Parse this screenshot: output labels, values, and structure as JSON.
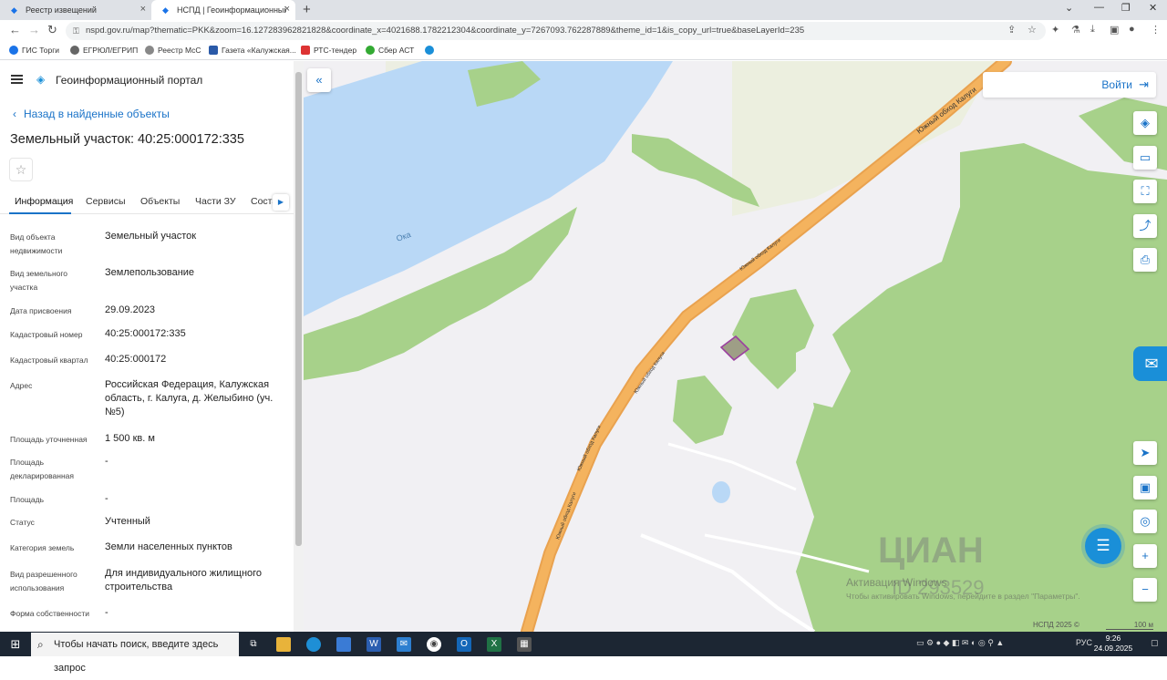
{
  "browser": {
    "tabs": [
      {
        "title": "Реестр извещений",
        "active": false
      },
      {
        "title": "НСПД | Геоинформационный п",
        "active": true
      }
    ],
    "url": "nspd.gov.ru/map?thematic=PKK&zoom=16.127283962821828&coordinate_x=4021688.1782212304&coordinate_y=7267093.762287889&theme_id=1&is_copy_url=true&baseLayerId=235",
    "bookmarks": [
      "ГИС Торги",
      "ЕГРЮЛ/ЕГРИП",
      "Реестр МсС",
      "Газета «Калужская...",
      "РТС-тендер",
      "Сбер АСТ"
    ]
  },
  "panel": {
    "portal_title": "Геоинформационный портал",
    "back_link": "Назад в найденные объекты",
    "title": "Земельный участок: 40:25:000172:335",
    "tabs": [
      "Информация",
      "Сервисы",
      "Объекты",
      "Части ЗУ",
      "Соста"
    ],
    "active_tab": "Информация",
    "rows": [
      {
        "label": "Вид объекта недвижимости",
        "value": "Земельный участок"
      },
      {
        "label": "Вид земельного участка",
        "value": "Землепользование"
      },
      {
        "label": "Дата присвоения",
        "value": "29.09.2023"
      },
      {
        "label": "Кадастровый номер",
        "value": "40:25:000172:335"
      },
      {
        "label": "Кадастровый квартал",
        "value": "40:25:000172"
      },
      {
        "label": "Адрес",
        "value": "Российская Федерация, Калужская область, г. Калуга, д. Желыбино (уч. №5)"
      },
      {
        "label": "Площадь уточненная",
        "value": "1 500 кв. м"
      },
      {
        "label": "Площадь декларированная",
        "value": "-"
      },
      {
        "label": "Площадь",
        "value": "-"
      },
      {
        "label": "Статус",
        "value": "Учтенный"
      },
      {
        "label": "Категория земель",
        "value": "Земли населенных пунктов"
      },
      {
        "label": "Вид разрешенного использования",
        "value": "Для индивидуального жилищного строительства"
      },
      {
        "label": "Форма собственности",
        "value": "-"
      }
    ]
  },
  "map": {
    "login_label": "Войти",
    "river_label": "Ока",
    "road_labels": [
      "Южный обход Калуги",
      "Южный обход Калуги",
      "Южный обход Калуги",
      "Южный обход Калуги"
    ],
    "road_main_label": "Южный обход Калуги",
    "watermark_cian": "ЦИАН",
    "watermark_id": "ID 293529",
    "activation_title": "Активация Windows",
    "activation_text": "Чтобы активировать Windows, перейдите в раздел \"Параметры\".",
    "attribution": "НСПД 2025 ©",
    "scale_label": "100 м",
    "colors": {
      "water": "#b9d8f6",
      "forest": "#a7d18a",
      "road": "#f4b35e",
      "parcel": "#9b3fa0"
    }
  },
  "taskbar": {
    "search_placeholder": "Чтобы начать поиск, введите здесь запрос",
    "language": "РУС",
    "time": "9:26",
    "date": "24.09.2025"
  }
}
